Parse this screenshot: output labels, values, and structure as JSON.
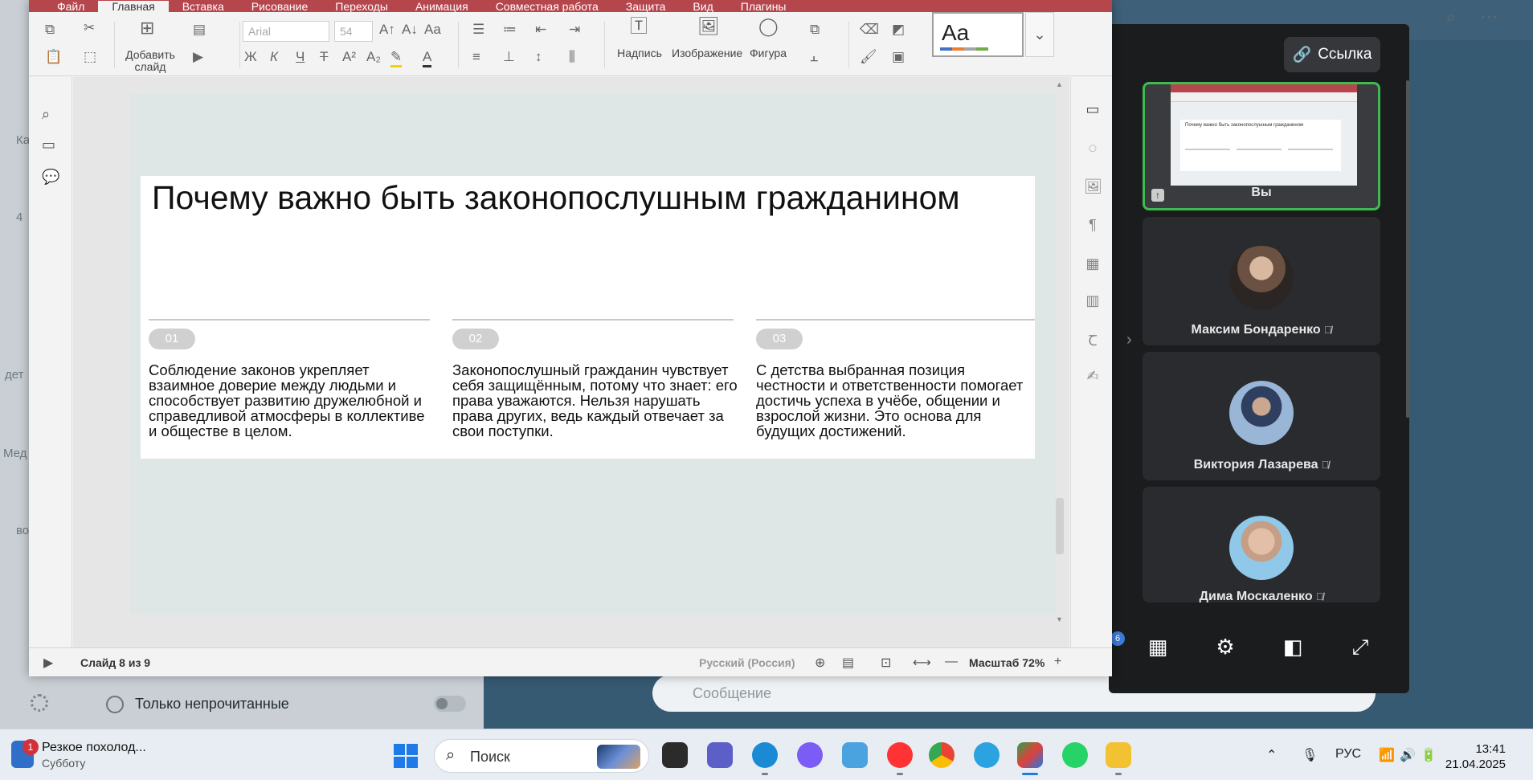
{
  "editor": {
    "menu": [
      "Файл",
      "Главная",
      "Вставка",
      "Рисование",
      "Переходы",
      "Анимация",
      "Совместная работа",
      "Защита",
      "Вид",
      "Плагины"
    ],
    "active_tab": "Главная",
    "toolbar": {
      "add_slide": "Добавить слайд",
      "font_name": "Arial",
      "font_size": "54",
      "textbox": "Надпись",
      "image": "Изображение",
      "shape": "Фигура",
      "style_preview": "Aa",
      "bold": "Ж",
      "italic": "К",
      "underline": "Ч",
      "strike": "Т"
    },
    "status": {
      "slide_counter": "Слайд 8 из 9",
      "language": "Русский (Россия)",
      "zoom": "Масштаб 72%"
    }
  },
  "slide": {
    "title": "Почему важно быть законопослушным гражданином",
    "columns": [
      {
        "num": "01",
        "text": "Соблюдение законов укрепляет взаимное доверие между людьми и способствует развитию дружелюбной и справедливой атмосферы в коллективе и обществе в целом."
      },
      {
        "num": "02",
        "text": "Законопослушный гражданин чувствует себя защищённым, потому что знает: его права уважаются. Нельзя нарушать права других, ведь каждый отвечает за свои поступки."
      },
      {
        "num": "03",
        "text": "С детства выбранная позиция честности и ответственности помогает достичь успеха в учёбе, общении и взрослой жизни. Это основа для будущих достижений."
      }
    ]
  },
  "call": {
    "link_button": "Ссылка",
    "participants": [
      {
        "name": "Вы",
        "self": true
      },
      {
        "name": "Максим Бондаренко",
        "muted": true
      },
      {
        "name": "Виктория Лазарева",
        "muted": true
      },
      {
        "name": "Дима Москаленко",
        "muted": true
      }
    ],
    "badge": "6",
    "self_thumb_title": "Почему важно быть законопослушным гражданином"
  },
  "messenger": {
    "left_fragments": [
      "Ка",
      "4",
      "дет",
      "Мед",
      "во"
    ],
    "unread_only": "Только непрочитанные",
    "message_placeholder": "Сообщение"
  },
  "taskbar": {
    "notification": {
      "badge": "1",
      "title": "Резкое похолод...",
      "subtitle": "Субботу"
    },
    "search_placeholder": "Поиск",
    "lang": "РУС",
    "time": "13:41",
    "date": "21.04.2025"
  },
  "colors": {
    "editor_accent": "#b5464c",
    "slide_bg": "#dfe6e6",
    "call_active_border": "#3fb950",
    "windows_blue": "#1e7ae8"
  }
}
